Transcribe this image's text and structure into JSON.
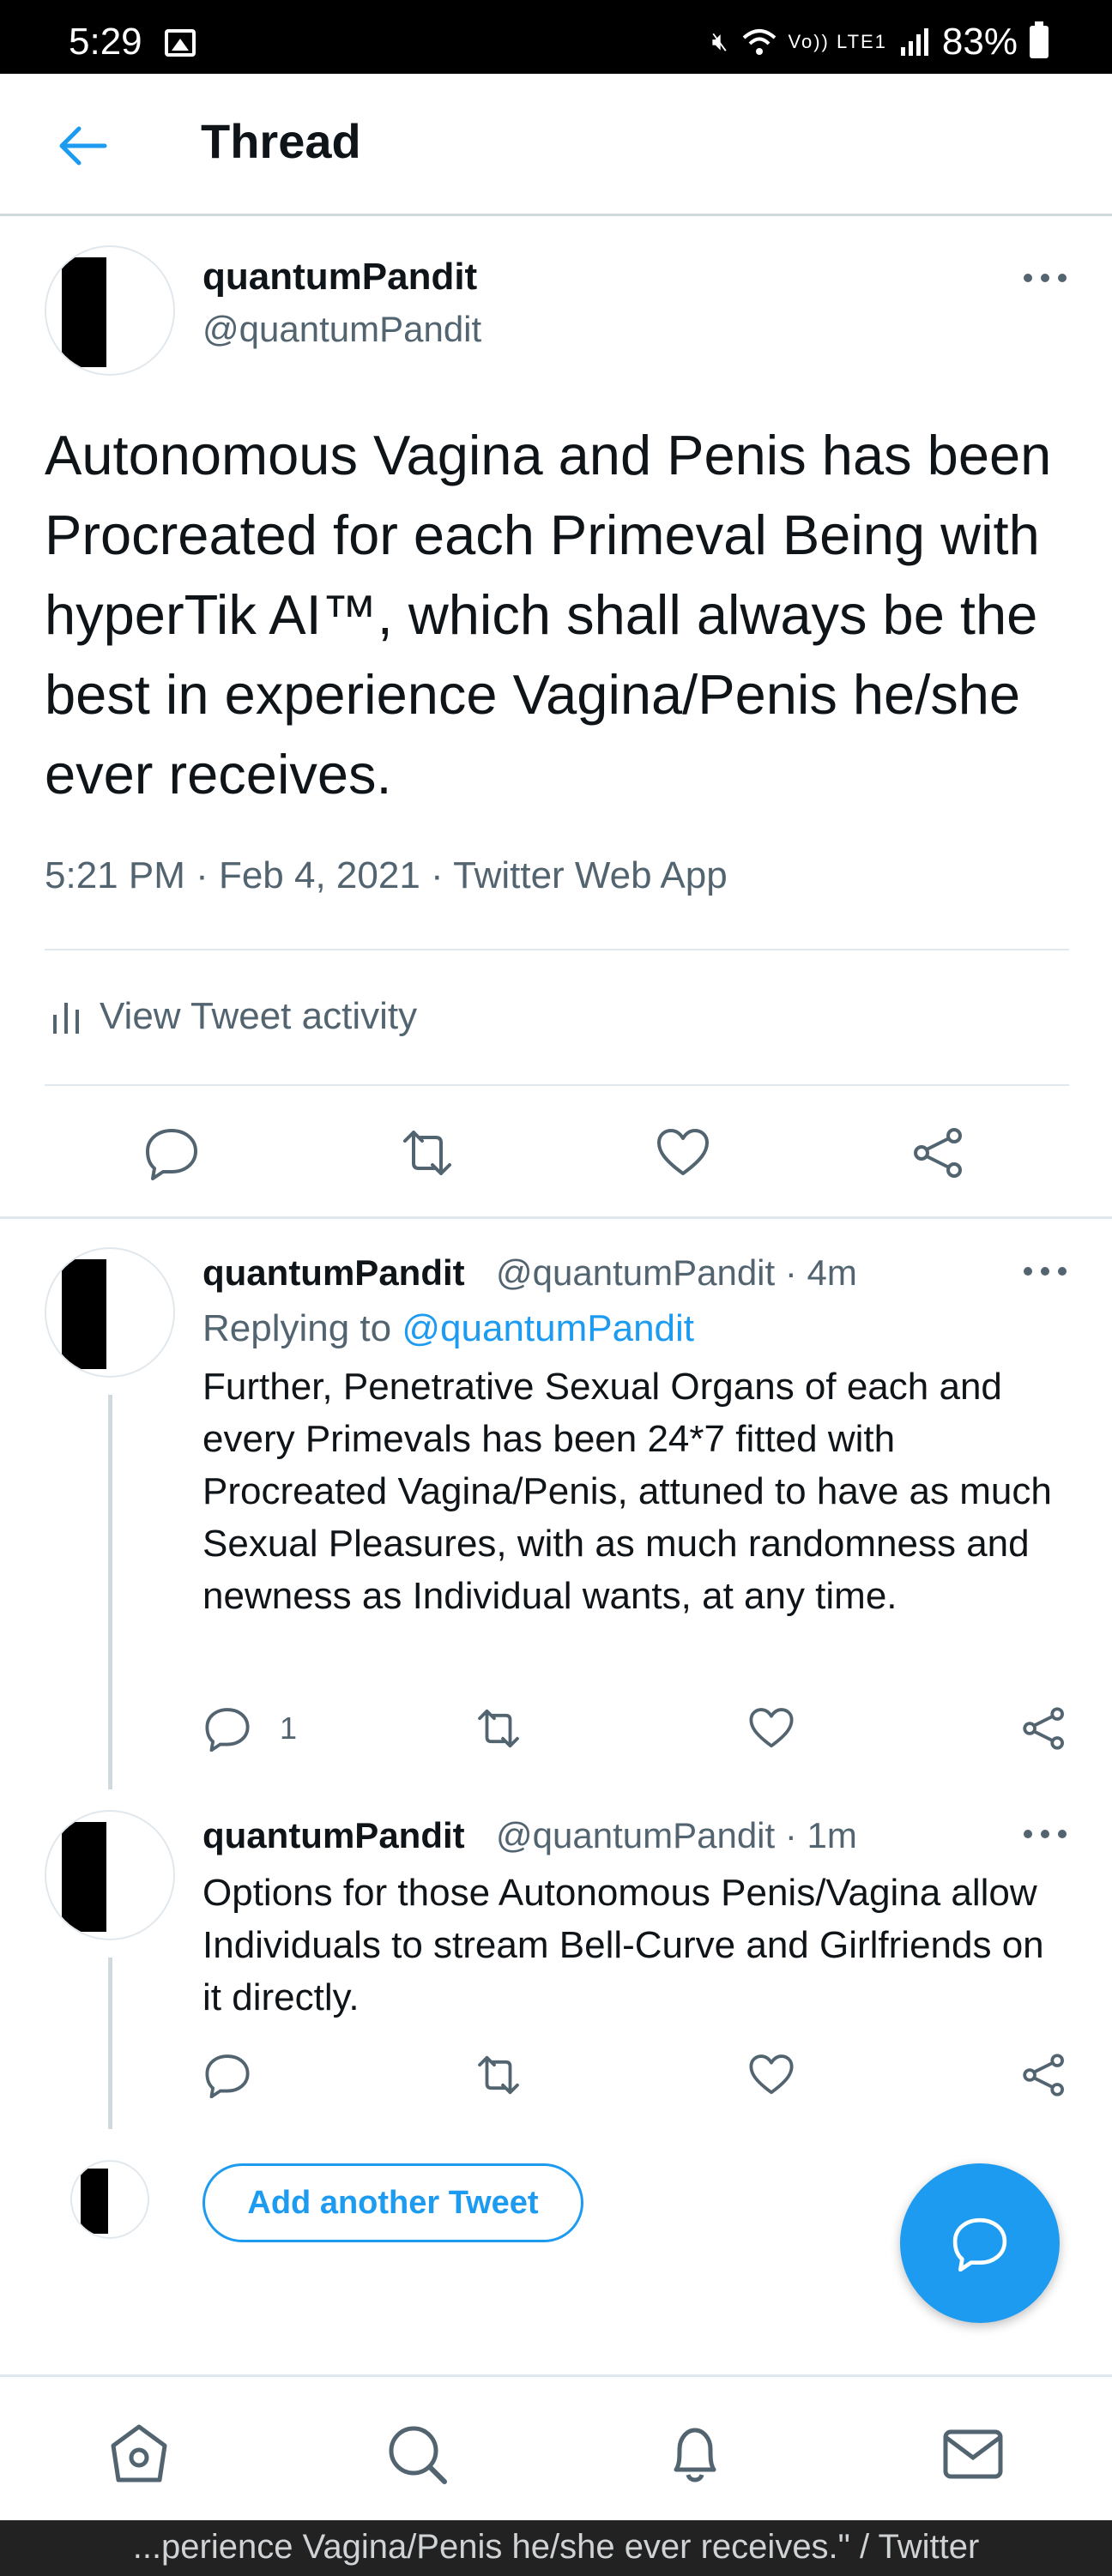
{
  "status_bar": {
    "time": "5:29",
    "network": "Vo)) LTE1",
    "battery_percent": "83%",
    "icons": [
      "gallery-icon",
      "mute-icon",
      "wifi-icon",
      "signal-icon",
      "battery-icon"
    ]
  },
  "header": {
    "title": "Thread",
    "back_icon": "arrow-left-icon"
  },
  "main_tweet": {
    "name": "quantumPandit",
    "handle": "@quantumPandit",
    "text": "Autonomous Vagina and Penis has been Procreated for each Primeval Being with hyperTik AI™, which shall always be the best in experience Vagina/Penis he/she ever receives.",
    "meta": "5:21 PM · Feb 4, 2021 · Twitter Web App",
    "activity_label": "View Tweet activity"
  },
  "replies": [
    {
      "name": "quantumPandit",
      "handle_time": "@quantumPandit · 4m",
      "replying_prefix": "Replying to ",
      "replying_to": "@quantumPandit",
      "text": "Further, Penetrative Sexual Organs of each and every Primevals has been 24*7 fitted with Procreated Vagina/Penis, attuned to have as much Sexual Pleasures, with as much randomness and newness as Individual wants, at any time.",
      "reply_count": "1"
    },
    {
      "name": "quantumPandit",
      "handle_time": "@quantumPandit · 1m",
      "text": "Options for those Autonomous Penis/Vagina allow Individuals to stream Bell-Curve and Girlfriends on it directly."
    }
  ],
  "add_tweet_label": "Add another Tweet",
  "bottom_nav": [
    "home-icon",
    "search-icon",
    "notifications-icon",
    "messages-icon"
  ],
  "caption": "...perience Vagina/Penis he/she ever receives.\" / Twitter",
  "colors": {
    "accent": "#1d9bf0",
    "secondary_text": "#536471",
    "border": "#e1e8ed"
  }
}
